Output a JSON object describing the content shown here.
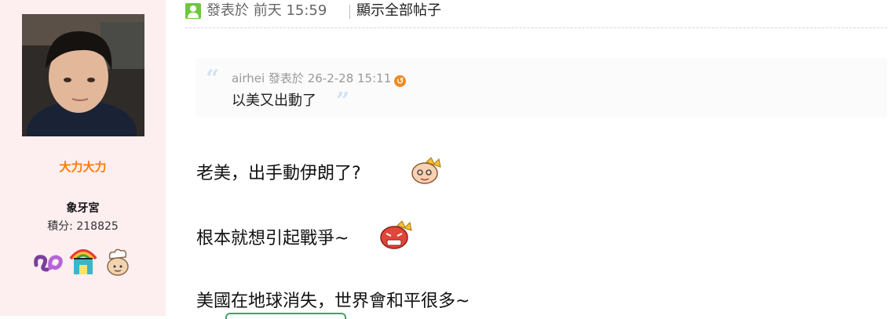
{
  "user": {
    "name": "大力大力",
    "group": "象牙宮",
    "points_label": "積分: ",
    "points": "218825",
    "medals": [
      "snake-medal-icon",
      "rainbow-house-medal-icon",
      "chef-medal-icon"
    ]
  },
  "post": {
    "posted_at": "發表於 前天 15:59",
    "show_all_label": "顯示全部帖子",
    "quote": {
      "meta": "airhei 發表於 26-2-28 15:11",
      "text": "以美又出動了"
    },
    "body_lines": [
      "老美，出手動伊朗了?",
      "根本就想引起戰爭~",
      "美國在地球消失，世界會和平很多~"
    ]
  },
  "colors": {
    "sidebar_bg": "#fdeef0",
    "username": "#ff7a00",
    "online": "#6ec73c"
  }
}
